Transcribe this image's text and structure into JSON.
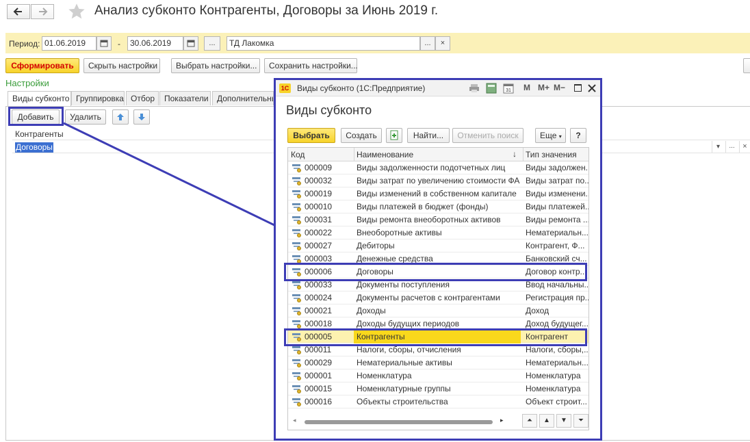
{
  "window": {
    "title": "Анализ субконто Контрагенты, Договоры  за Июнь 2019 г."
  },
  "params": {
    "period_label": "Период:",
    "date_from": "01.06.2019",
    "date_sep": "-",
    "date_to": "30.06.2019",
    "ellipsis": "...",
    "org": "ТД Лакомка",
    "org_ellipsis": "...",
    "clear": "×"
  },
  "toolbar": {
    "generate": "Сформировать",
    "hide_settings": "Скрыть настройки",
    "choose_settings": "Выбрать настройки...",
    "save_settings": "Сохранить настройки..."
  },
  "settings": {
    "title": "Настройки",
    "tabs": [
      "Виды субконто",
      "Группировка",
      "Отбор",
      "Показатели",
      "Дополнительные"
    ],
    "add": "Добавить",
    "remove": "Удалить",
    "list_header": "Контрагенты",
    "list_selected": "Договоры",
    "field_controls": [
      "▾",
      "...",
      "×"
    ]
  },
  "dialog": {
    "window_title": "Виды субконто  (1С:Предприятие)",
    "logo": "1С",
    "title_buttons": [
      "M",
      "M+",
      "M−"
    ],
    "heading": "Виды субконто",
    "select": "Выбрать",
    "create": "Создать",
    "find": "Найти...",
    "cancel_search": "Отменить поиск",
    "more": "Еще",
    "help": "?",
    "columns": {
      "code": "Код",
      "name": "Наименование",
      "sort": "↓",
      "type": "Тип значения"
    },
    "rows": [
      {
        "code": "000009",
        "name": "Виды задолженности подотчетных лиц",
        "type": "Виды задолжен..."
      },
      {
        "code": "000032",
        "name": "Виды затрат по увеличению стоимости ФА",
        "type": "Виды затрат по..."
      },
      {
        "code": "000019",
        "name": "Виды изменений в собственном капитале",
        "type": "Виды изменени..."
      },
      {
        "code": "000010",
        "name": "Виды платежей в бюджет (фонды)",
        "type": "Виды платежей..."
      },
      {
        "code": "000031",
        "name": "Виды ремонта внеоборотных активов",
        "type": "Виды ремонта ..."
      },
      {
        "code": "000022",
        "name": "Внеоборотные активы",
        "type": "Нематериальн..."
      },
      {
        "code": "000027",
        "name": "Дебиторы",
        "type": "Контрагент, Ф..."
      },
      {
        "code": "000003",
        "name": "Денежные средства",
        "type": "Банковский сч..."
      },
      {
        "code": "000006",
        "name": "Договоры",
        "type": "Договор контр..."
      },
      {
        "code": "000033",
        "name": "Документы поступления",
        "type": "Ввод начальны..."
      },
      {
        "code": "000024",
        "name": "Документы расчетов с контрагентами",
        "type": "Регистрация пр..."
      },
      {
        "code": "000021",
        "name": "Доходы",
        "type": "Доход"
      },
      {
        "code": "000018",
        "name": "Доходы будущих периодов",
        "type": "Доход будущег..."
      },
      {
        "code": "000005",
        "name": "Контрагенты",
        "type": "Контрагент"
      },
      {
        "code": "000011",
        "name": "Налоги, сборы, отчисления",
        "type": "Налоги, сборы,..."
      },
      {
        "code": "000029",
        "name": "Нематериальные активы",
        "type": "Нематериальн..."
      },
      {
        "code": "000001",
        "name": "Номенклатура",
        "type": "Номенклатура"
      },
      {
        "code": "000015",
        "name": "Номенклатурные группы",
        "type": "Номенклатура"
      },
      {
        "code": "000016",
        "name": "Объекты строительства",
        "type": "Объект строит..."
      }
    ],
    "nav": [
      "⏶",
      "▲",
      "▼",
      "⏷"
    ]
  },
  "colors": {
    "accent_yellow": "#f7d32a",
    "generate_text": "#d40000",
    "highlight_blue": "#3d3db5",
    "selected_row": "#f9d81c",
    "settings_green": "#3a9c3a"
  }
}
